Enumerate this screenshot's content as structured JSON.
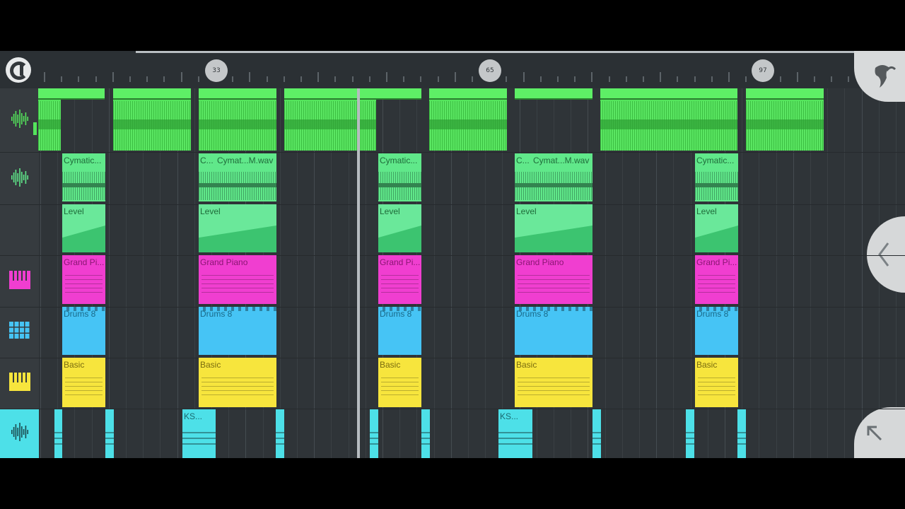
{
  "ruler": {
    "markers": [
      "33",
      "65",
      "97"
    ]
  },
  "tracks": [
    {
      "name": "audio-track",
      "icon": "waveform-icon"
    },
    {
      "name": "audio-track-2",
      "icon": "waveform-icon"
    },
    {
      "name": "automation-track",
      "icon": ""
    },
    {
      "name": "grand-piano-track",
      "icon": "piano-keys-icon"
    },
    {
      "name": "drums-track",
      "icon": "drum-pads-icon"
    },
    {
      "name": "basic-track",
      "icon": "piano-keys-icon"
    },
    {
      "name": "ks-track",
      "icon": "waveform-icon"
    }
  ],
  "labels": {
    "cym_short": "Cymatic...",
    "cym_c": "C...",
    "cym_wav": "Cymat...M.wav",
    "level": "Level",
    "piano_short": "Grand Pi...",
    "piano_full": "Grand Piano",
    "drums": "Drums 8",
    "basic": "Basic",
    "ks": "KS..."
  },
  "colors": {
    "audio": "#54e45c",
    "cymatic": "#60e88a",
    "piano": "#f03ed0",
    "drums": "#46c4f5",
    "basic": "#f7e53d",
    "ks": "#4de0e8"
  },
  "icons": {
    "logo": "fl-logo-icon",
    "fruit": "fruit-menu-icon",
    "back": "chevron-left-icon",
    "expand": "arrow-up-left-icon"
  }
}
